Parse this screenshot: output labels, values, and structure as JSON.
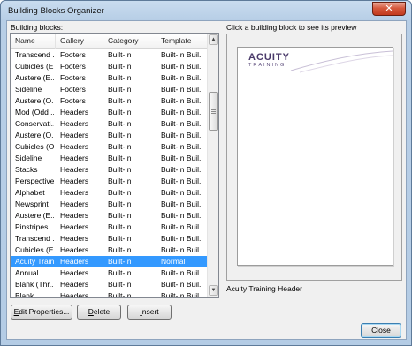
{
  "window": {
    "title": "Building Blocks Organizer",
    "close_glyph": "✕"
  },
  "left_label": "Building blocks:",
  "columns": [
    "Name",
    "Gallery",
    "Category",
    "Template"
  ],
  "rows": [
    [
      "Transcend ...",
      "Footers",
      "Built-In",
      "Built-In Buil..."
    ],
    [
      "Cubicles (E...",
      "Footers",
      "Built-In",
      "Built-In Buil..."
    ],
    [
      "Austere (E...",
      "Footers",
      "Built-In",
      "Built-In Buil..."
    ],
    [
      "Sideline",
      "Footers",
      "Built-In",
      "Built-In Buil..."
    ],
    [
      "Austere (O...",
      "Footers",
      "Built-In",
      "Built-In Buil..."
    ],
    [
      "Mod (Odd ...",
      "Headers",
      "Built-In",
      "Built-In Buil..."
    ],
    [
      "Conservati...",
      "Headers",
      "Built-In",
      "Built-In Buil..."
    ],
    [
      "Austere (O...",
      "Headers",
      "Built-In",
      "Built-In Buil..."
    ],
    [
      "Cubicles (O...",
      "Headers",
      "Built-In",
      "Built-In Buil..."
    ],
    [
      "Sideline",
      "Headers",
      "Built-In",
      "Built-In Buil..."
    ],
    [
      "Stacks",
      "Headers",
      "Built-In",
      "Built-In Buil..."
    ],
    [
      "Perspective",
      "Headers",
      "Built-In",
      "Built-In Buil..."
    ],
    [
      "Alphabet",
      "Headers",
      "Built-In",
      "Built-In Buil..."
    ],
    [
      "Newsprint",
      "Headers",
      "Built-In",
      "Built-In Buil..."
    ],
    [
      "Austere (E...",
      "Headers",
      "Built-In",
      "Built-In Buil..."
    ],
    [
      "Pinstripes",
      "Headers",
      "Built-In",
      "Built-In Buil..."
    ],
    [
      "Transcend ...",
      "Headers",
      "Built-In",
      "Built-In Buil..."
    ],
    [
      "Cubicles (E...",
      "Headers",
      "Built-In",
      "Built-In Buil..."
    ],
    [
      "Acuity Traini...",
      "Headers",
      "Built-In",
      "Normal"
    ],
    [
      "Annual",
      "Headers",
      "Built-In",
      "Built-In Buil..."
    ],
    [
      "Blank (Thr...",
      "Headers",
      "Built-In",
      "Built-In Buil..."
    ],
    [
      "Blank",
      "Headers",
      "Built-In",
      "Built-In Buil..."
    ]
  ],
  "selected_index": 18,
  "preview": {
    "label": "Click a building block to see its preview",
    "logo_word": "ACUITY",
    "logo_sub": "TRAINING",
    "caption": "Acuity Training Header"
  },
  "buttons": {
    "edit_accel": "E",
    "edit_rest": "dit Properties...",
    "delete_accel": "D",
    "delete_rest": "elete",
    "insert_accel": "I",
    "insert_rest": "nsert",
    "close": "Close"
  },
  "colors": {
    "selection": "#3399ff",
    "logo": "#4a3a6a"
  }
}
